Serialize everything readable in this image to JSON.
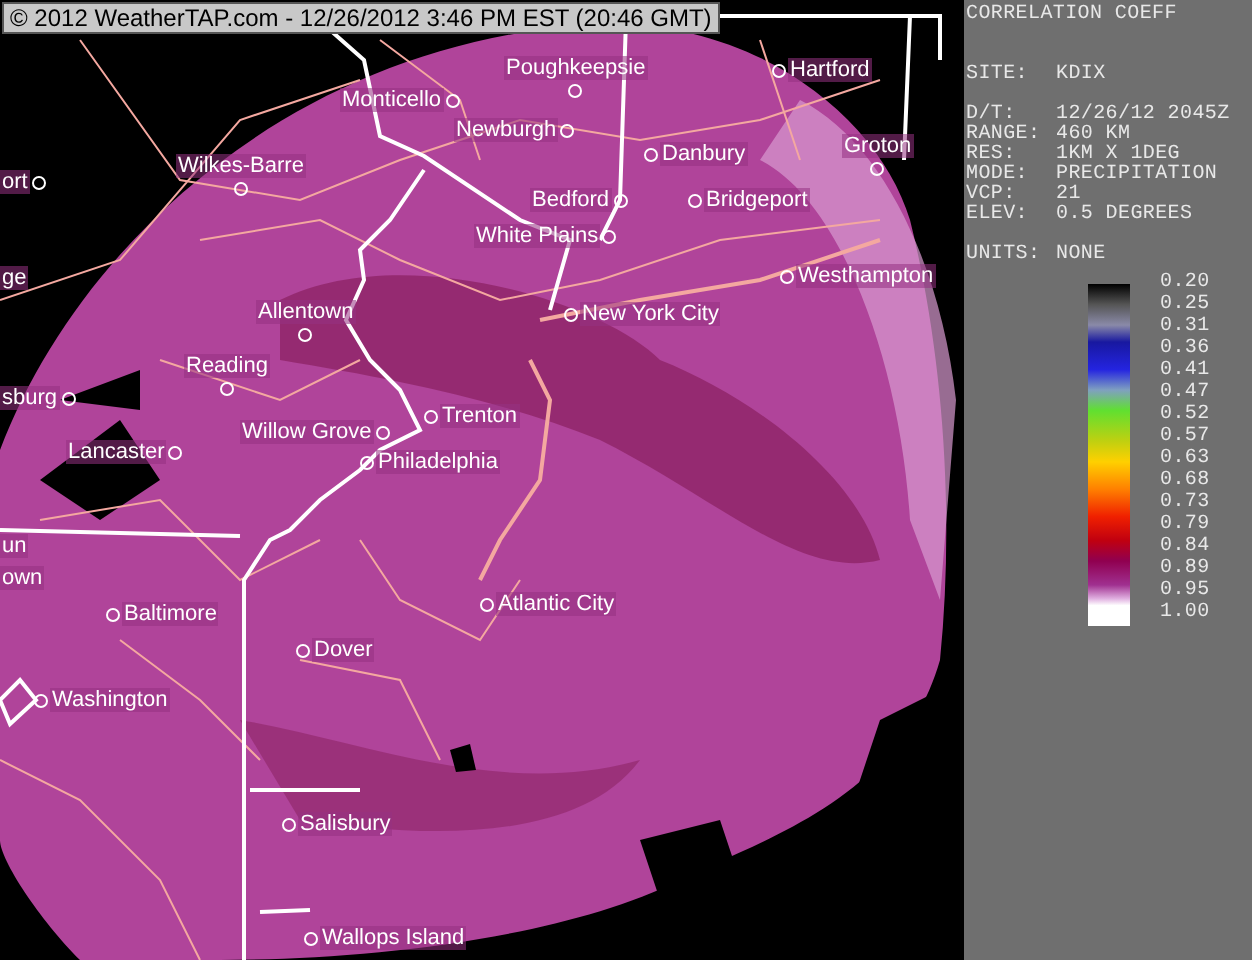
{
  "banner": "© 2012 WeatherTAP.com - 12/26/2012  3:46 PM EST (20:46 GMT)",
  "map": {
    "cities": [
      {
        "name": "Poughkeepsie",
        "kind": "below"
      },
      {
        "name": "Monticello",
        "kind": "after"
      },
      {
        "name": "Newburgh",
        "kind": "after"
      },
      {
        "name": "Danbury",
        "kind": "before"
      },
      {
        "name": "Hartford",
        "kind": "before"
      },
      {
        "name": "Groton",
        "kind": "below"
      },
      {
        "name": "Wilkes-Barre",
        "kind": "below"
      },
      {
        "name": "Bedford",
        "kind": "after"
      },
      {
        "name": "Bridgeport",
        "kind": "before"
      },
      {
        "name": "White Plains",
        "kind": "after"
      },
      {
        "name": "Westhampton",
        "kind": "before"
      },
      {
        "name": "Allentown",
        "kind": "below"
      },
      {
        "name": "New York City",
        "kind": "before"
      },
      {
        "name": "Reading",
        "kind": "below"
      },
      {
        "name": "sburg",
        "kind": "after"
      },
      {
        "name": "Trenton",
        "kind": "before"
      },
      {
        "name": "Willow Grove",
        "kind": "after"
      },
      {
        "name": "Lancaster",
        "kind": "after"
      },
      {
        "name": "Philadelphia",
        "kind": "before"
      },
      {
        "name": "Atlantic City",
        "kind": "before"
      },
      {
        "name": "Baltimore",
        "kind": "before"
      },
      {
        "name": "Dover",
        "kind": "before"
      },
      {
        "name": "Washington",
        "kind": "before"
      },
      {
        "name": "Salisbury",
        "kind": "before"
      },
      {
        "name": "Wallops Island",
        "kind": "before"
      },
      {
        "name": "ort",
        "kind": "after"
      },
      {
        "name": "ge",
        "kind": "plain"
      },
      {
        "name": "un",
        "kind": "plain"
      },
      {
        "name": "own",
        "kind": "plain"
      }
    ]
  },
  "panel": {
    "title": "CORRELATION COEFF",
    "site": {
      "label": "SITE:",
      "value": "KDIX"
    },
    "details": [
      {
        "label": "D/T:",
        "value": "12/26/12 2045Z"
      },
      {
        "label": "RANGE:",
        "value": "460 KM"
      },
      {
        "label": "RES:",
        "value": "1KM X 1DEG"
      },
      {
        "label": "MODE:",
        "value": "PRECIPITATION"
      },
      {
        "label": "VCP:",
        "value": "21"
      },
      {
        "label": "ELEV:",
        "value": "0.5 DEGREES"
      }
    ],
    "units": {
      "label": "UNITS:",
      "value": "NONE"
    },
    "legend_ticks": [
      "0.20",
      "0.25",
      "0.31",
      "0.36",
      "0.41",
      "0.47",
      "0.52",
      "0.57",
      "0.63",
      "0.68",
      "0.73",
      "0.79",
      "0.84",
      "0.89",
      "0.95",
      "1.00"
    ]
  }
}
